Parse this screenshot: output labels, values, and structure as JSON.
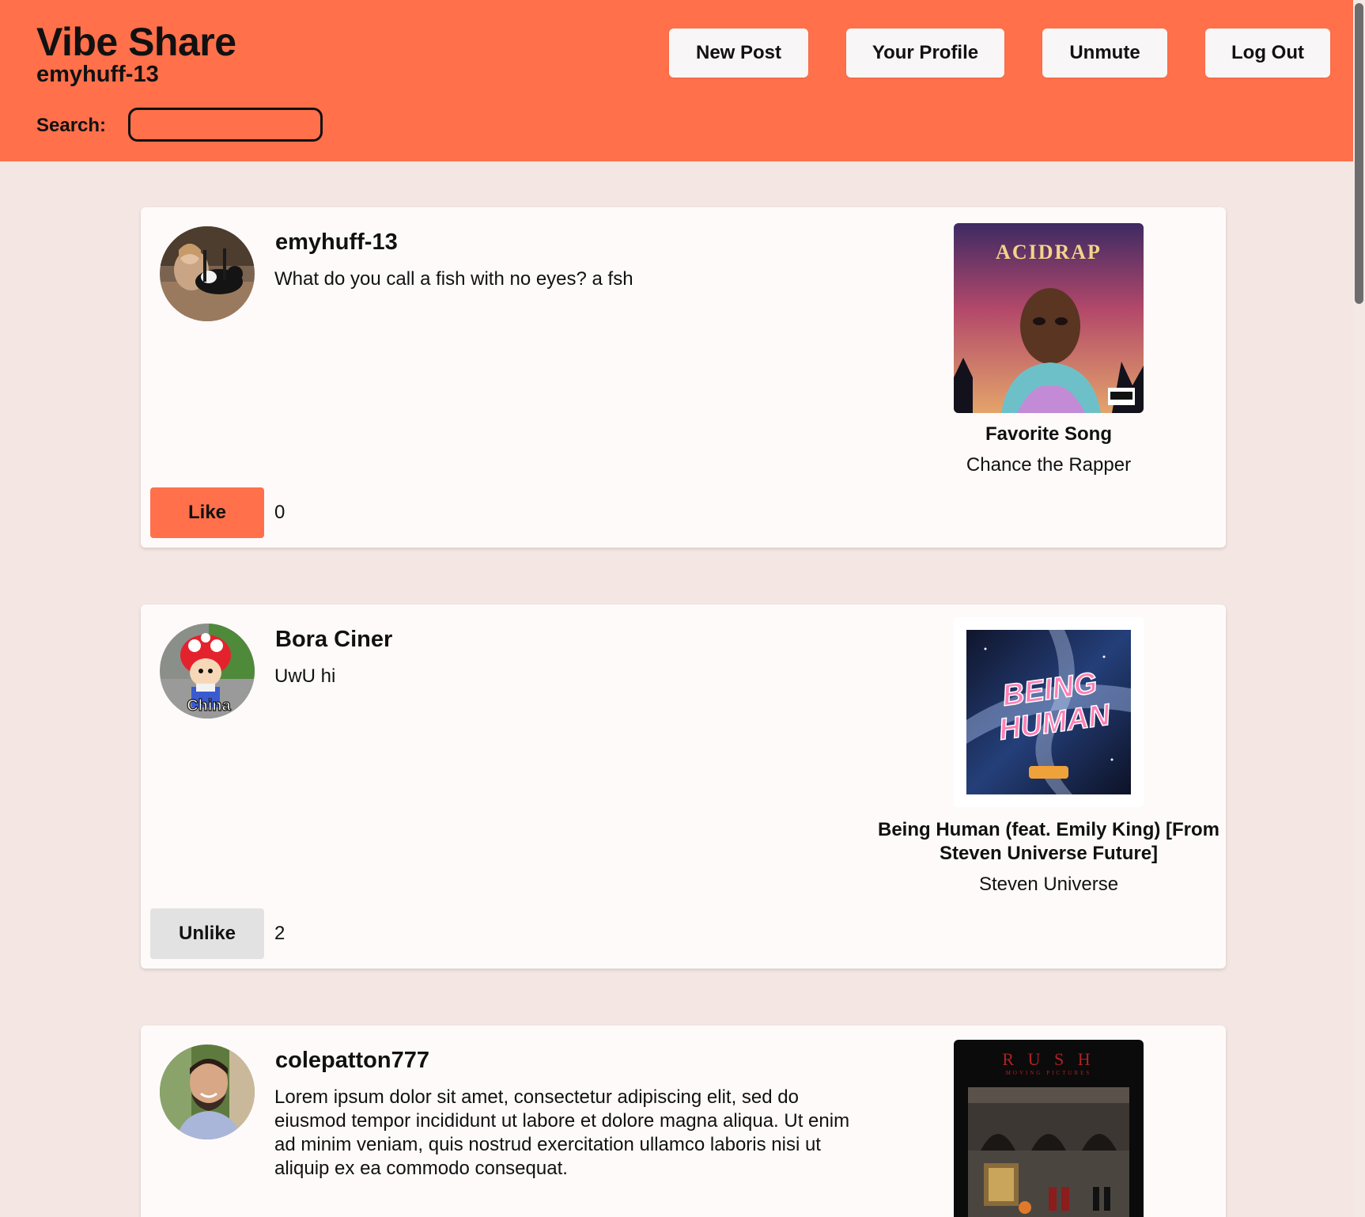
{
  "header": {
    "app_title": "Vibe Share",
    "current_user": "emyhuff-13",
    "search_label": "Search:",
    "search_value": "",
    "nav": {
      "new_post": "New Post",
      "your_profile": "Your Profile",
      "unmute": "Unmute",
      "log_out": "Log Out"
    }
  },
  "colors": {
    "header_bg": "#ff704b",
    "page_bg": "#f3e6e3",
    "card_bg": "#fffafa",
    "like_active": "#ff704b",
    "unlike": "#e2e2e2"
  },
  "posts": [
    {
      "username": "emyhuff-13",
      "text": "What do you call a fish with no eyes? a fsh",
      "song_title": "Favorite Song",
      "song_artist": "Chance the Rapper",
      "album_text": "ACIDRAP",
      "like_label": "Like",
      "like_count": "0"
    },
    {
      "username": "Bora Ciner",
      "text": "UwU hi",
      "avatar_caption": "China",
      "song_title": "Being Human (feat. Emily King) [From Steven Universe Future]",
      "song_artist": "Steven Universe",
      "album_text_line1": "BEING",
      "album_text_line2": "HUMAN",
      "like_label": "Unlike",
      "like_count": "2"
    },
    {
      "username": "colepatton777",
      "text": "Lorem ipsum dolor sit amet, consectetur adipiscing elit, sed do eiusmod tempor incididunt ut labore et dolore magna aliqua. Ut enim ad minim veniam, quis nostrud exercitation ullamco laboris nisi ut aliquip ex ea commodo consequat.",
      "album_text": "R U S H",
      "album_subtext": "MOVING PICTURES"
    }
  ]
}
